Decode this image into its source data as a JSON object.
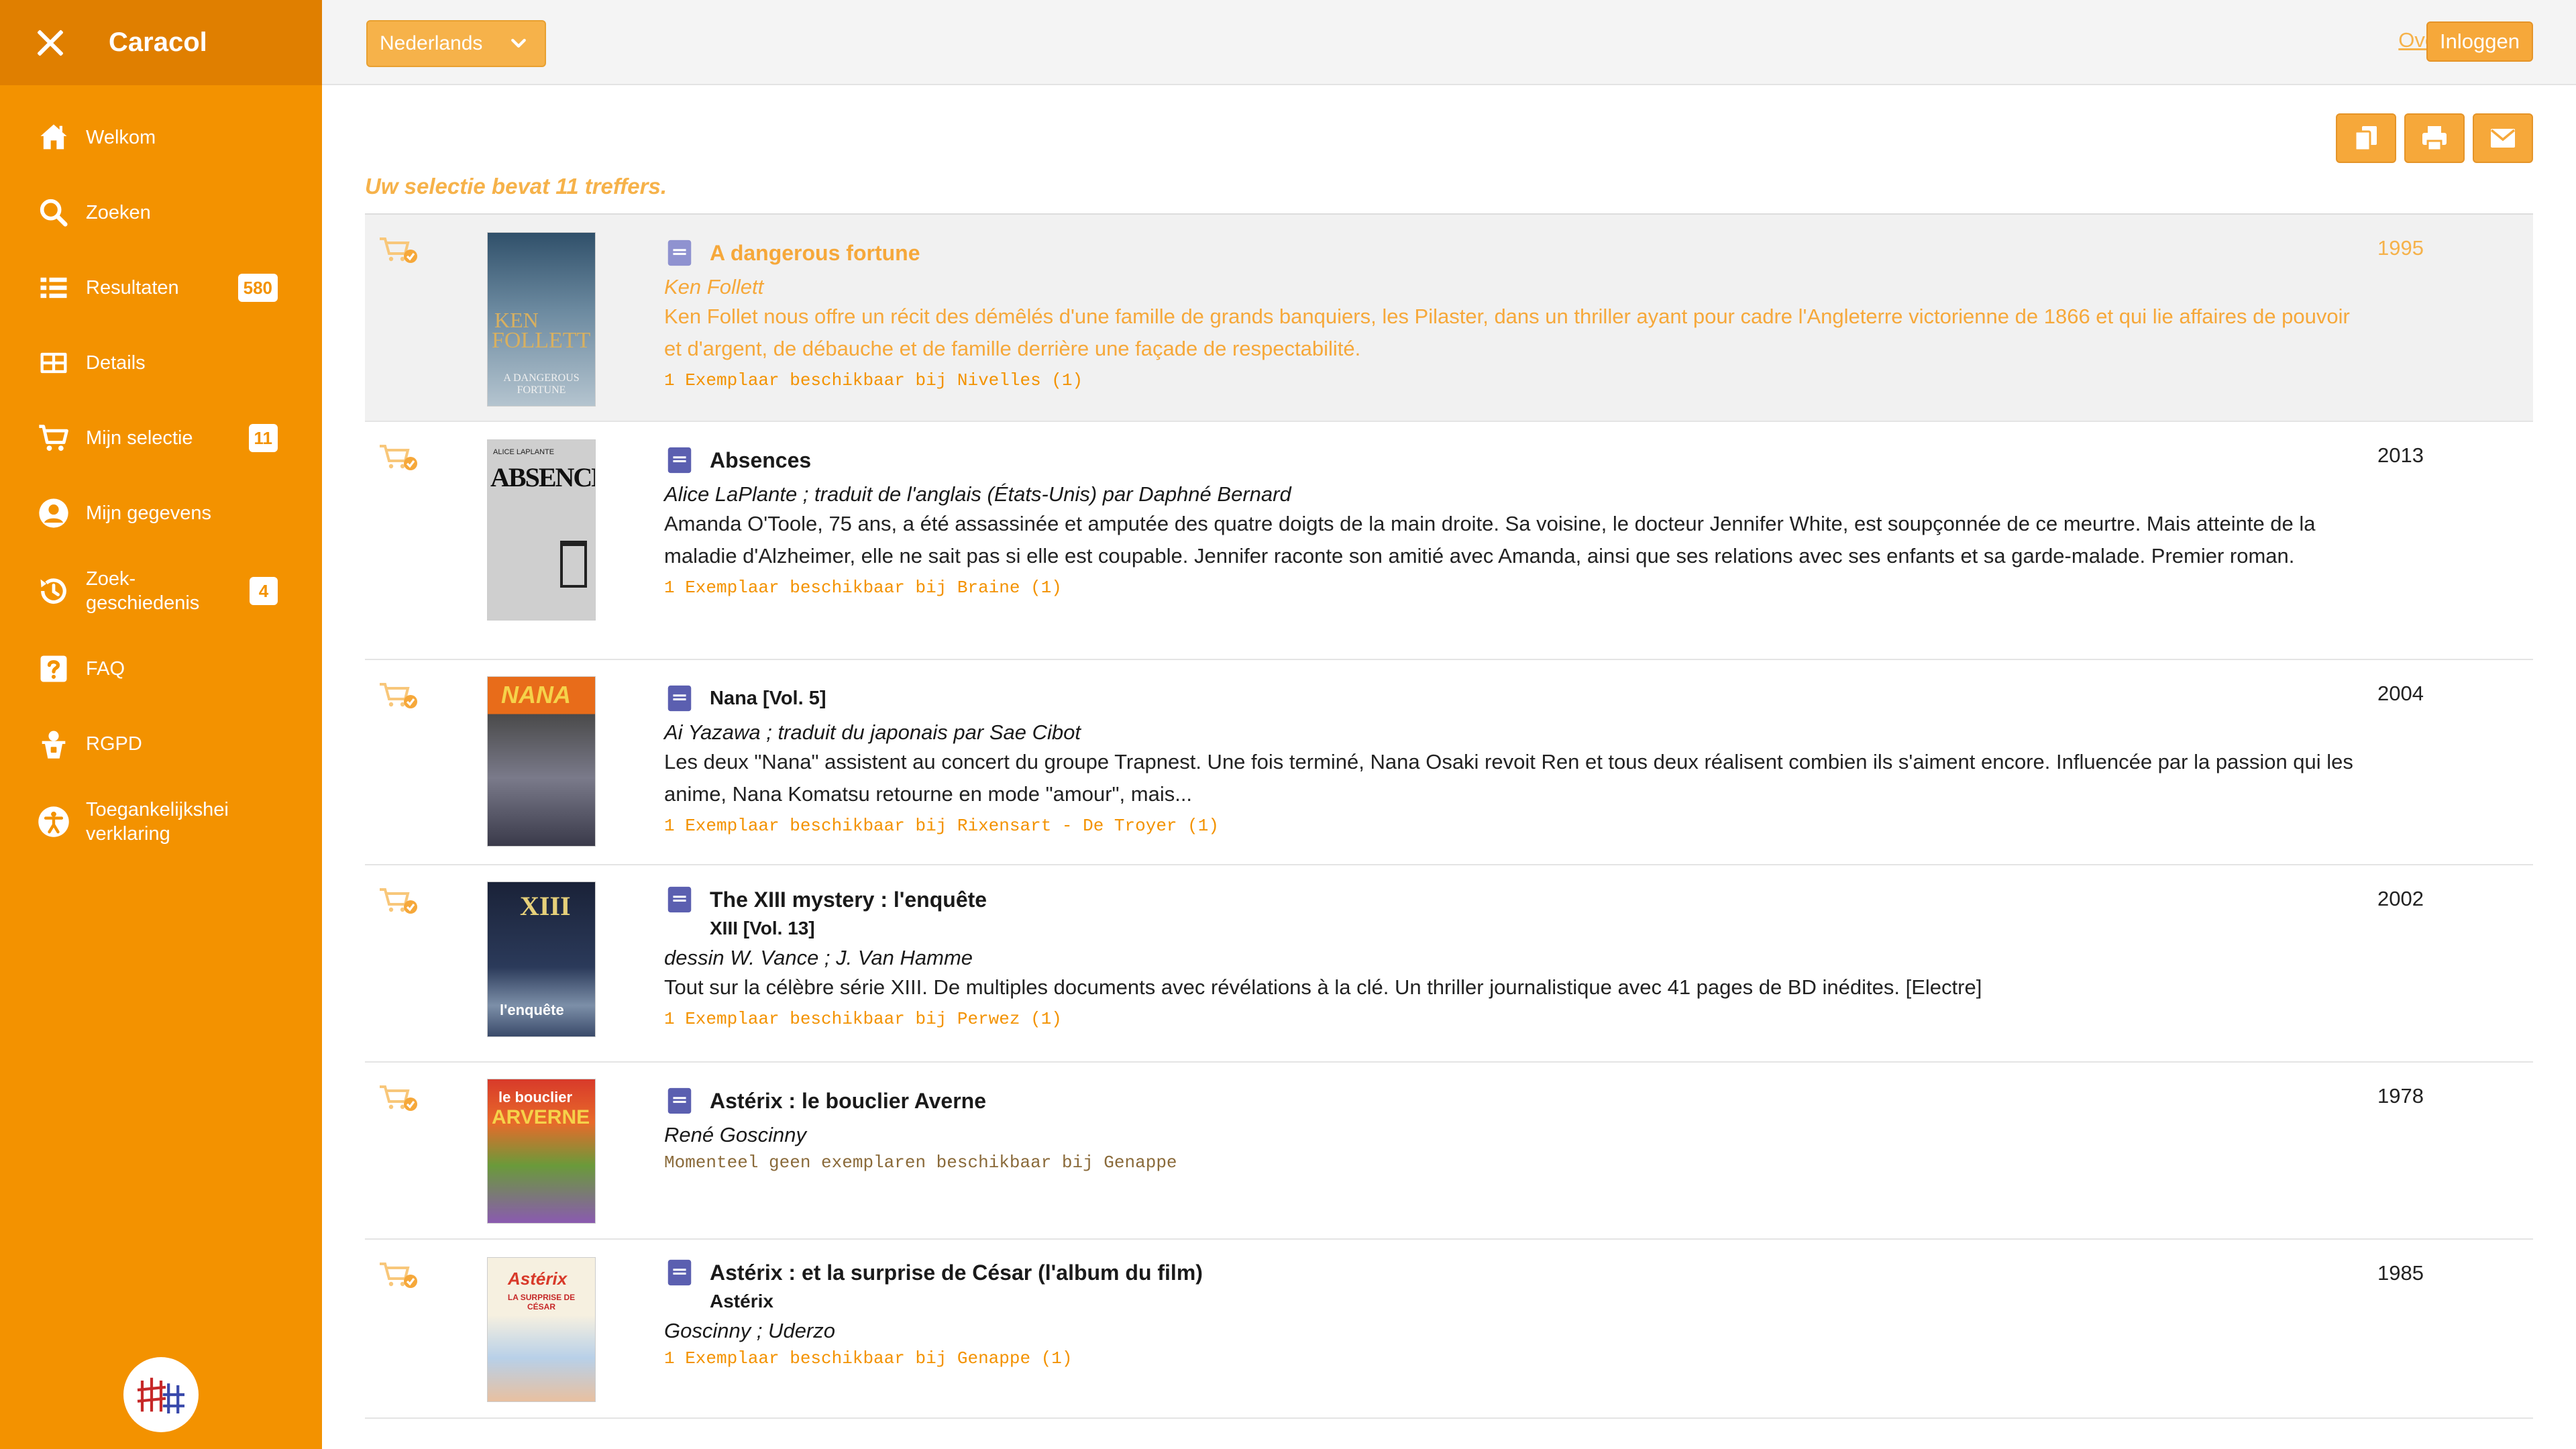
{
  "app": {
    "title": "Caracol"
  },
  "sidebar": {
    "items": [
      {
        "label": "Welkom",
        "icon": "home-icon"
      },
      {
        "label": "Zoeken",
        "icon": "search-icon"
      },
      {
        "label": "Resultaten",
        "icon": "list-icon",
        "badge": "580"
      },
      {
        "label": "Details",
        "icon": "details-icon"
      },
      {
        "label": "Mijn selectie",
        "icon": "cart-icon",
        "badge": "11"
      },
      {
        "label": "Mijn gegevens",
        "icon": "user-icon"
      },
      {
        "label_line1": "Zoek-",
        "label_line2": "geschiedenis",
        "icon": "history-icon",
        "badge": "4"
      },
      {
        "label": "FAQ",
        "icon": "help-icon"
      },
      {
        "label": "RGPD",
        "icon": "privacy-icon"
      },
      {
        "label_line1": "Toegankelijkshei",
        "label_line2": "verklaring",
        "icon": "accessibility-icon"
      }
    ]
  },
  "topbar": {
    "language": "Nederlands",
    "about": "Over..",
    "login": "Inloggen"
  },
  "main": {
    "result_count": "Uw selectie bevat 11 treffers."
  },
  "results": [
    {
      "title": "A dangerous fortune",
      "author": "Ken Follett",
      "description": "Ken Follet nous offre un récit des démêlés d'une famille de grands banquiers, les Pilaster, dans un thriller ayant pour cadre l'Angleterre victorienne de 1866 et qui lie affaires de pouvoir et d'argent, de débauche et de famille derrière une façade de respectabilité.",
      "availability": "1 Exemplaar beschikbaar bij Nivelles (1)",
      "year": "1995",
      "cover": {
        "text_top": "KEN",
        "text_mid": "FOLLETT",
        "text_bottom": "A DANGEROUS FORTUNE"
      }
    },
    {
      "title": "Absences",
      "author": "Alice LaPlante ; traduit de l'anglais (États-Unis) par Daphné Bernard",
      "description": "Amanda O'Toole, 75 ans, a été assassinée et amputée des quatre doigts de la main droite. Sa voisine, le docteur Jennifer White, est soupçonnée de ce meurtre. Mais atteinte de la maladie d'Alzheimer, elle ne sait pas si elle est coupable. Jennifer raconte son amitié avec Amanda, ainsi que ses relations avec ses enfants et sa garde-malade. Premier roman.",
      "availability": "1 Exemplaar beschikbaar bij Braine (1)",
      "year": "2013",
      "cover": {
        "text_top": "ALICE LAPLANTE",
        "text_mid": "ABSENCES"
      }
    },
    {
      "title": "Nana [Vol. 5]",
      "author": "Ai Yazawa ; traduit du japonais par Sae Cibot",
      "description": "Les deux \"Nana\" assistent au concert du groupe Trapnest. Une fois terminé, Nana Osaki revoit Ren et tous deux réalisent combien ils s'aiment encore. Influencée par la passion qui les anime, Nana Komatsu retourne en mode \"amour\", mais...",
      "availability": "1 Exemplaar beschikbaar bij Rixensart - De Troyer (1)",
      "year": "2004",
      "cover": {
        "text_top": "NANA"
      }
    },
    {
      "title": "The XIII mystery : l'enquête",
      "subtitle": "XIII [Vol. 13]",
      "author": "dessin W. Vance ; J. Van Hamme",
      "description": "Tout sur la célèbre série XIII. De multiples documents avec révélations à la clé. Un thriller journalistique avec 41 pages de BD inédites. [Electre]",
      "availability": "1 Exemplaar beschikbaar bij Perwez (1)",
      "year": "2002",
      "cover": {
        "text_top": "XIII",
        "text_bottom": "l'enquête"
      }
    },
    {
      "title": "Astérix : le bouclier Averne",
      "author": "René Goscinny",
      "availability": "Momenteel geen exemplaren beschikbaar bij Genappe",
      "year": "1978",
      "cover": {
        "text_top": "le bouclier",
        "text_mid": "ARVERNE"
      }
    },
    {
      "title": "Astérix : et la surprise de César (l'album du film)",
      "subtitle": "Astérix",
      "author": "Goscinny ; Uderzo",
      "availability": "1 Exemplaar beschikbaar bij Genappe (1)",
      "year": "1985",
      "cover": {
        "text_top": "Astérix",
        "text_mid": "LA SURPRISE DE CÉSAR"
      }
    }
  ],
  "colors": {
    "brand": "#f39200",
    "brand_dark": "#e07f00",
    "accent_light": "#f6b24a",
    "book_icon": "#5b5fb0"
  }
}
